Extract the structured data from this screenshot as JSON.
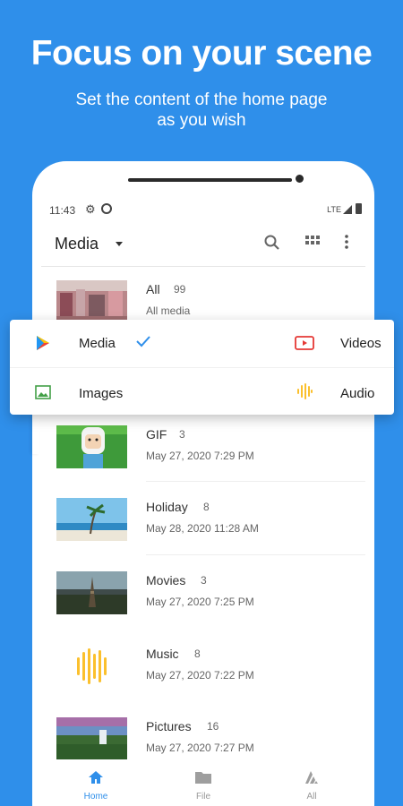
{
  "promo": {
    "headline": "Focus on your scene",
    "subline_1": "Set the content of the home page",
    "subline_2": "as you wish"
  },
  "status_bar": {
    "time": "11:43",
    "network": "LTE"
  },
  "app_bar": {
    "title": "Media",
    "icons": [
      "search-icon",
      "grid-icon",
      "more-vert-icon"
    ]
  },
  "albums": [
    {
      "name": "All",
      "count": "99",
      "subtitle": "All media"
    },
    {
      "name": "GIF",
      "count": "3",
      "subtitle": "May 27, 2020 7:29 PM"
    },
    {
      "name": "Holiday",
      "count": "8",
      "subtitle": "May 28, 2020 11:28 AM"
    },
    {
      "name": "Movies",
      "count": "3",
      "subtitle": "May 27, 2020 7:25 PM"
    },
    {
      "name": "Music",
      "count": "8",
      "subtitle": "May 27, 2020 7:22 PM"
    },
    {
      "name": "Pictures",
      "count": "16",
      "subtitle": "May 27, 2020 7:27 PM"
    }
  ],
  "filter_menu": {
    "options": [
      {
        "label": "Media",
        "icon": "play-triangle-icon",
        "selected": true
      },
      {
        "label": "Videos",
        "icon": "video-icon",
        "selected": false
      },
      {
        "label": "Images",
        "icon": "image-icon",
        "selected": false
      },
      {
        "label": "Audio",
        "icon": "audio-wave-icon",
        "selected": false
      }
    ]
  },
  "bottom_nav": {
    "items": [
      {
        "label": "Home",
        "icon": "home-icon",
        "active": true
      },
      {
        "label": "File",
        "icon": "folder-icon",
        "active": false
      },
      {
        "label": "All",
        "icon": "all-icon",
        "active": false
      }
    ]
  },
  "colors": {
    "background": "#2f8fea",
    "accent": "#2f8fea",
    "video_red": "#e53935",
    "image_green": "#43a047",
    "audio_yellow": "#fbc02d"
  }
}
